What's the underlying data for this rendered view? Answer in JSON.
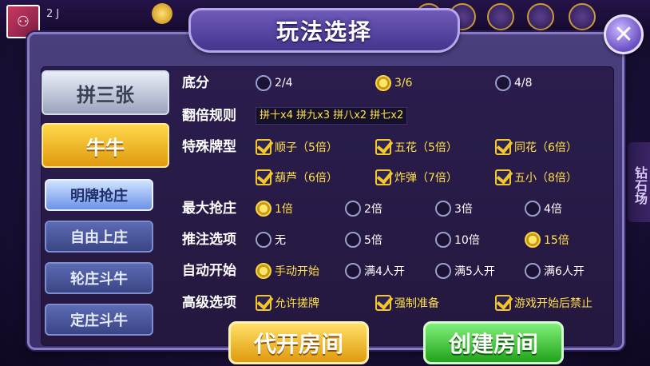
{
  "background": {
    "user_id": "2   J",
    "side_label": "钻石场"
  },
  "dialog": {
    "title": "玩法选择",
    "close_glyph": "✕"
  },
  "tabs": {
    "main": [
      {
        "label": "拼三张",
        "active": false
      },
      {
        "label": "牛牛",
        "active": true
      }
    ],
    "sub": [
      {
        "label": "明牌抢庄",
        "active": true
      },
      {
        "label": "自由上庄",
        "active": false
      },
      {
        "label": "轮庄斗牛",
        "active": false
      },
      {
        "label": "定庄斗牛",
        "active": false
      }
    ]
  },
  "rows": {
    "base_score": {
      "label": "底分",
      "options": [
        {
          "label": "2/4",
          "selected": false
        },
        {
          "label": "3/6",
          "selected": true
        },
        {
          "label": "4/8",
          "selected": false
        }
      ]
    },
    "double_rule": {
      "label": "翻倍规则",
      "value": "拼十x4 拼九x3 拼八x2 拼七x2"
    },
    "special_cards": {
      "label": "特殊牌型",
      "options": [
        {
          "label": "顺子（5倍）",
          "checked": true
        },
        {
          "label": "五花（5倍）",
          "checked": true
        },
        {
          "label": "同花（6倍）",
          "checked": true
        },
        {
          "label": "葫芦（6倍）",
          "checked": true
        },
        {
          "label": "炸弹（7倍）",
          "checked": true
        },
        {
          "label": "五小（8倍）",
          "checked": true
        }
      ]
    },
    "max_bid": {
      "label": "最大抢庄",
      "options": [
        {
          "label": "1倍",
          "selected": true
        },
        {
          "label": "2倍",
          "selected": false
        },
        {
          "label": "3倍",
          "selected": false
        },
        {
          "label": "4倍",
          "selected": false
        }
      ]
    },
    "push_bet": {
      "label": "推注选项",
      "options": [
        {
          "label": "无",
          "selected": false
        },
        {
          "label": "5倍",
          "selected": false
        },
        {
          "label": "10倍",
          "selected": false
        },
        {
          "label": "15倍",
          "selected": true
        }
      ]
    },
    "auto_start": {
      "label": "自动开始",
      "options": [
        {
          "label": "手动开始",
          "selected": true
        },
        {
          "label": "满4人开",
          "selected": false
        },
        {
          "label": "满5人开",
          "selected": false
        },
        {
          "label": "满6人开",
          "selected": false
        }
      ]
    },
    "advanced": {
      "label": "高级选项",
      "options": [
        {
          "label": "允许搓牌",
          "checked": true
        },
        {
          "label": "强制准备",
          "checked": true
        },
        {
          "label": "游戏开始后禁止",
          "checked": true
        }
      ]
    }
  },
  "buttons": {
    "proxy_open": "代开房间",
    "create_room": "创建房间"
  }
}
